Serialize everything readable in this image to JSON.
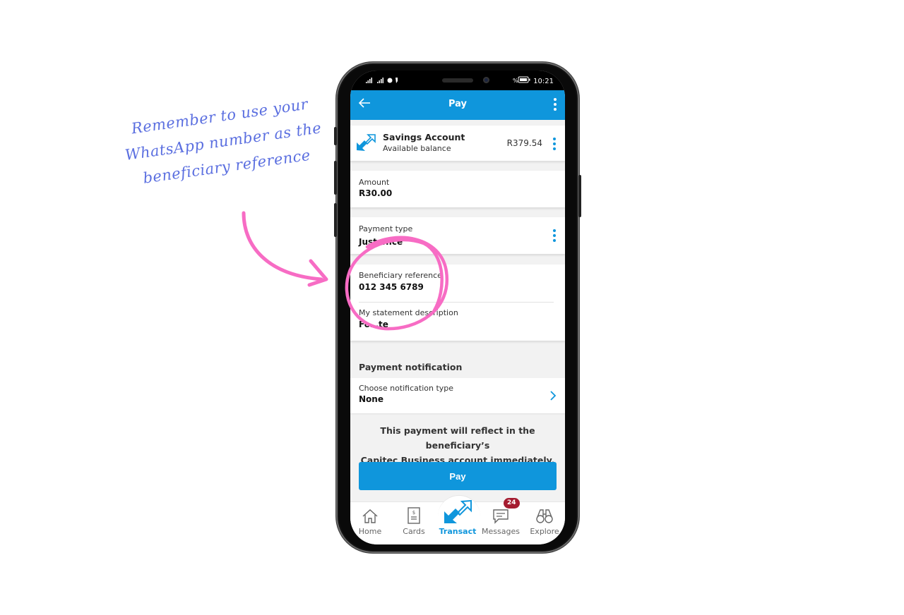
{
  "annotation": {
    "lines": [
      "Remember to use your",
      "WhatsApp number as the",
      "beneficiary reference"
    ],
    "text_color": "#5b6fe0",
    "highlight_color": "#f76cc4"
  },
  "status_bar": {
    "signal": "4G 4G",
    "time": "10:21",
    "battery": "battery-icon"
  },
  "app_bar": {
    "title": "Pay",
    "color": "#0f96dc"
  },
  "from_account": {
    "name": "Savings Account",
    "sublabel": "Available balance",
    "balance": "R379.54"
  },
  "amount": {
    "label": "Amount",
    "value": "R30.00"
  },
  "payment_type": {
    "label": "Payment type",
    "value": "Just once"
  },
  "beneficiary_reference": {
    "label": "Beneficiary reference",
    "value": "012 345 6789"
  },
  "statement_description": {
    "label": "My statement description",
    "value": "Fo…te"
  },
  "payment_notification": {
    "section_title": "Payment notification",
    "label": "Choose notification type",
    "value": "None"
  },
  "info_text": {
    "line1": "This payment will reflect in the beneficiary’s",
    "line2": "Capitec Business account immediately."
  },
  "pay_button": "Pay",
  "bottom_nav": {
    "items": [
      {
        "label": "Home",
        "icon": "home-icon"
      },
      {
        "label": "Cards",
        "icon": "cards-icon"
      },
      {
        "label": "Transact",
        "icon": "transact-icon",
        "active": true
      },
      {
        "label": "Messages",
        "icon": "messages-icon",
        "badge": "24"
      },
      {
        "label": "Explore",
        "icon": "binoculars-icon"
      }
    ]
  }
}
